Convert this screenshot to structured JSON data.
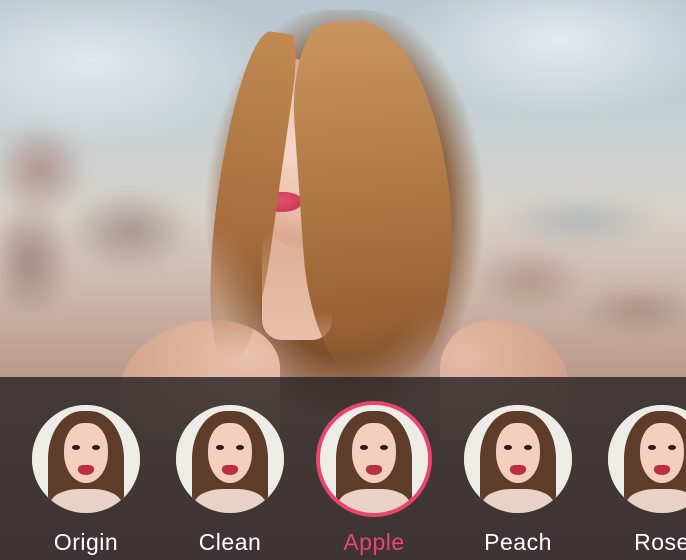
{
  "colors": {
    "accent": "#e8456f",
    "strip_background": "rgba(38,34,36,0.80)",
    "label_default": "#ffffff"
  },
  "filters": [
    {
      "label": "Origin",
      "selected": false
    },
    {
      "label": "Clean",
      "selected": false
    },
    {
      "label": "Apple",
      "selected": true
    },
    {
      "label": "Peach",
      "selected": false
    },
    {
      "label": "Rose",
      "selected": false
    }
  ]
}
